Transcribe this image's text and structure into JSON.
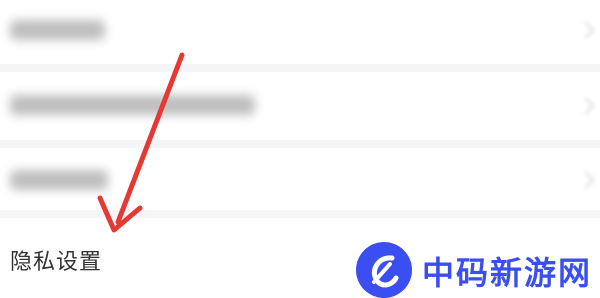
{
  "settings_list": {
    "rows": [
      {
        "label": "",
        "blurred": true
      },
      {
        "label": "",
        "blurred": true
      },
      {
        "label": "",
        "blurred": true
      },
      {
        "label": "隐私设置",
        "blurred": false
      }
    ]
  },
  "annotation": {
    "arrow_color": "#e53935",
    "target": "privacy-settings"
  },
  "watermark": {
    "text": "中码新游网",
    "brand_color": "#3a4ef2"
  }
}
